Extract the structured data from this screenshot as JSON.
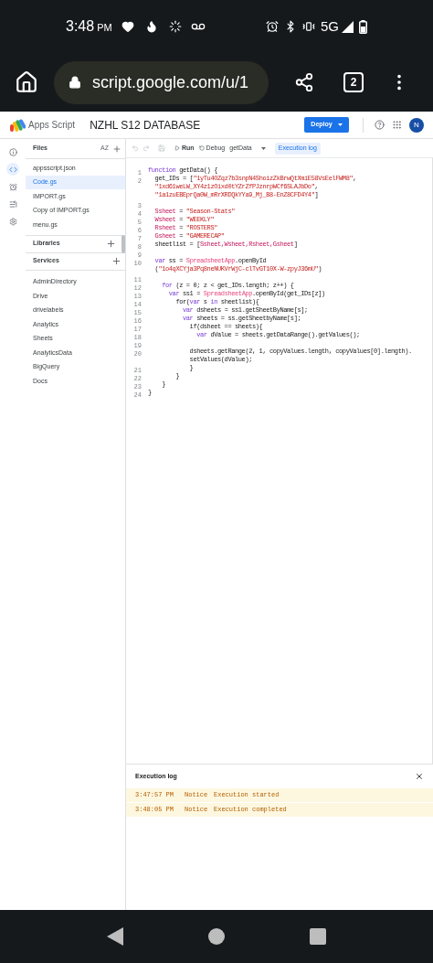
{
  "status_bar": {
    "time": "3:48",
    "ampm": "PM",
    "network": "5G"
  },
  "browser": {
    "url": "script.google.com/u/1",
    "tab_count": "2"
  },
  "header": {
    "app_name": "Apps Script",
    "project": "NZHL S12 DATABASE",
    "deploy": "Deploy",
    "avatar": "N"
  },
  "rail": [
    {
      "kind": "info",
      "selected": false
    },
    {
      "kind": "code",
      "selected": true
    },
    {
      "kind": "triggers",
      "selected": false
    },
    {
      "kind": "executions",
      "selected": false
    },
    {
      "kind": "settings",
      "selected": false
    }
  ],
  "sidebar": {
    "files_title": "Files",
    "sort_label": "AZ",
    "files": [
      {
        "name": "appsscript.json",
        "selected": false
      },
      {
        "name": "Code.gs",
        "selected": true
      },
      {
        "name": "IMPORT.gs",
        "selected": false
      },
      {
        "name": "Copy of IMPORT.gs",
        "selected": false
      },
      {
        "name": "menu.gs",
        "selected": false
      }
    ],
    "libraries": "Libraries",
    "services": "Services",
    "service_items": [
      "AdminDirectory",
      "Drive",
      "drivelabels",
      "Analytics",
      "Sheets",
      "AnalyticsData",
      "BigQuery",
      "Docs"
    ]
  },
  "toolbar": {
    "run": "Run",
    "debug": "Debug",
    "function": "getData",
    "execution_log": {
      "label": "Execution log",
      "selected": true
    }
  },
  "code": [
    {
      "number": "1",
      "tokens": [
        {
          "kind": "keyword",
          "text": "function"
        },
        {
          "kind": "plain",
          "text": " getData() {"
        }
      ]
    },
    {
      "number": "2",
      "tokens": [
        {
          "kind": "plain",
          "text": "  get_IDs = ["
        },
        {
          "kind": "string",
          "text": "\"1yTu4OZqz7b3snpN4ShoizZkBrwQtXmiE58VsEelFWM8\""
        },
        {
          "kind": "plain",
          "text": ","
        }
      ]
    },
    {
      "tokens": [
        {
          "kind": "string",
          "text": "  \"1xd61weLW_XY4z1zOixd0tYZrZfPJznrpWCf6SLAJbDo\""
        },
        {
          "kind": "plain",
          "text": ","
        }
      ]
    },
    {
      "tokens": [
        {
          "kind": "string",
          "text": "  \"1a1zuEBEprQa0W_mRrXRDQkYYa9_Mj_B8-EnZ8CFD4Y4\""
        },
        {
          "kind": "plain",
          "text": "]"
        }
      ]
    },
    {
      "number": "3"
    },
    {
      "number": "4",
      "tokens": [
        {
          "kind": "variable",
          "text": "  Ssheet"
        },
        {
          "kind": "plain",
          "text": " = "
        },
        {
          "kind": "string",
          "text": "\"Season-Stats\""
        }
      ]
    },
    {
      "number": "5",
      "tokens": [
        {
          "kind": "variable",
          "text": "  Wsheet"
        },
        {
          "kind": "plain",
          "text": " = "
        },
        {
          "kind": "string",
          "text": "\"WEEKLY\""
        }
      ]
    },
    {
      "number": "6",
      "tokens": [
        {
          "kind": "variable",
          "text": "  Rsheet"
        },
        {
          "kind": "plain",
          "text": " = "
        },
        {
          "kind": "string",
          "text": "\"ROSTERS\""
        }
      ]
    },
    {
      "number": "7",
      "tokens": [
        {
          "kind": "variable",
          "text": "  Gsheet"
        },
        {
          "kind": "plain",
          "text": " = "
        },
        {
          "kind": "string",
          "text": "\"GAMERECAP\""
        }
      ]
    },
    {
      "number": "8",
      "tokens": [
        {
          "kind": "plain",
          "text": "  sheetlist = ["
        },
        {
          "kind": "variable",
          "text": "Ssheet,Wsheet,Rsheet,Gsheet"
        },
        {
          "kind": "plain",
          "text": "]"
        }
      ]
    },
    {
      "number": "9"
    },
    {
      "number": "10",
      "tokens": [
        {
          "kind": "keyword",
          "text": "  var"
        },
        {
          "kind": "plain",
          "text": " ss = "
        },
        {
          "kind": "class",
          "text": "SpreadsheetApp"
        },
        {
          "kind": "plain",
          "text": ".openById"
        }
      ]
    },
    {
      "tokens": [
        {
          "kind": "plain",
          "text": "  ("
        },
        {
          "kind": "string",
          "text": "\"1o4qXCYja3Pq8neNUKVrWjC-clTvGT10X-W-zpyJ36mU\""
        },
        {
          "kind": "plain",
          "text": ")"
        }
      ]
    },
    {
      "number": "11"
    },
    {
      "number": "12",
      "tokens": [
        {
          "kind": "keyword",
          "text": "    for"
        },
        {
          "kind": "plain",
          "text": " (z = 0; z < get_IDs.length; z++) {"
        }
      ]
    },
    {
      "number": "13",
      "tokens": [
        {
          "kind": "keyword",
          "text": "      var"
        },
        {
          "kind": "plain",
          "text": " ss1 = "
        },
        {
          "kind": "class",
          "text": "SpreadsheetApp"
        },
        {
          "kind": "plain",
          "text": ".openById(get_IDs[z])"
        }
      ]
    },
    {
      "number": "14",
      "tokens": [
        {
          "kind": "plain",
          "text": "        for("
        },
        {
          "kind": "keyword",
          "text": "var"
        },
        {
          "kind": "plain",
          "text": " s "
        },
        {
          "kind": "keyword",
          "text": "in"
        },
        {
          "kind": "plain",
          "text": " sheetlist){"
        }
      ]
    },
    {
      "number": "15",
      "tokens": [
        {
          "kind": "keyword",
          "text": "          var"
        },
        {
          "kind": "plain",
          "text": " dsheets = ss1.getSheetByName[s];"
        }
      ]
    },
    {
      "number": "16",
      "tokens": [
        {
          "kind": "keyword",
          "text": "          var"
        },
        {
          "kind": "plain",
          "text": " sheets = ss.getSheetbyName[s];"
        }
      ]
    },
    {
      "number": "17",
      "tokens": [
        {
          "kind": "plain",
          "text": "            if(dsheet == sheets){"
        }
      ]
    },
    {
      "number": "18",
      "tokens": [
        {
          "kind": "keyword",
          "text": "              var"
        },
        {
          "kind": "plain",
          "text": " dValue = sheets.getDataRange().getValues();"
        }
      ]
    },
    {
      "number": "19"
    },
    {
      "number": "20",
      "tokens": [
        {
          "kind": "plain",
          "text": "            dsheets.getRange(2, 1, copyValues.length, copyValues[0].length)."
        }
      ]
    },
    {
      "tokens": [
        {
          "kind": "plain",
          "text": "            setValues(dValue);"
        }
      ]
    },
    {
      "number": "21",
      "tokens": [
        {
          "kind": "plain",
          "text": "            }"
        }
      ]
    },
    {
      "number": "22",
      "tokens": [
        {
          "kind": "plain",
          "text": "        }"
        }
      ]
    },
    {
      "number": "23",
      "tokens": [
        {
          "kind": "plain",
          "text": "    }"
        }
      ]
    },
    {
      "number": "24",
      "tokens": [
        {
          "kind": "plain",
          "text": "}"
        }
      ]
    }
  ],
  "log": {
    "title": "Execution log",
    "rows": [
      {
        "time": "3:47:57 PM",
        "level": "Notice",
        "message": "Execution started"
      },
      {
        "time": "3:48:05 PM",
        "level": "Notice",
        "message": "Execution completed"
      }
    ]
  }
}
